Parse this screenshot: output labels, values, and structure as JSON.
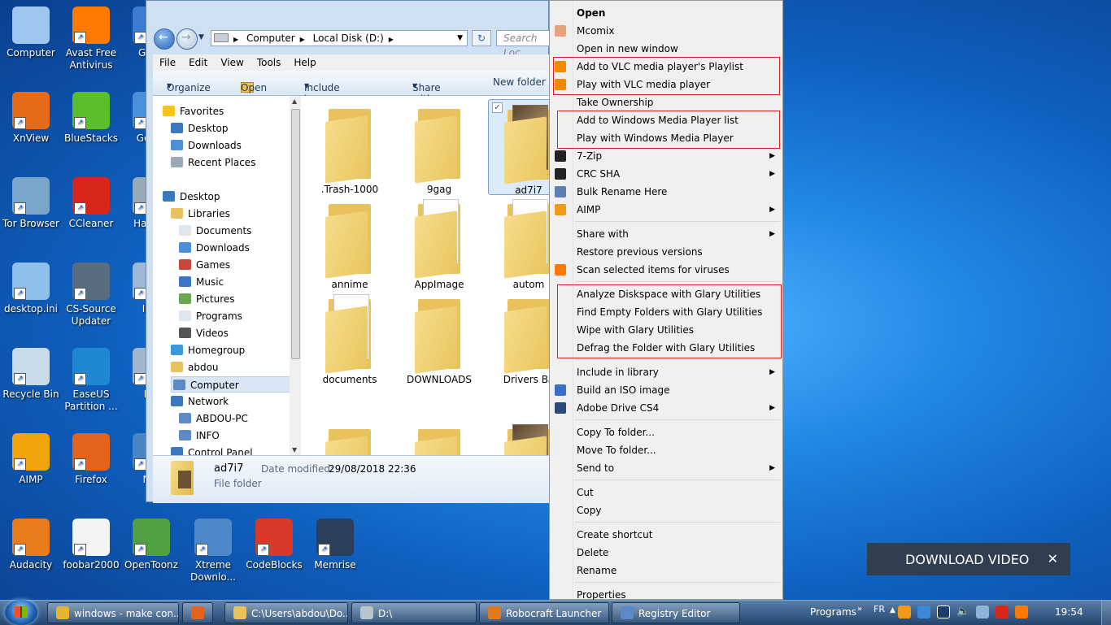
{
  "desktop": {
    "icons": [
      {
        "label": "Computer",
        "col": 0,
        "row": 0,
        "color": "#9ec7ef"
      },
      {
        "label": "Avast Free Antivirus",
        "col": 1,
        "row": 0,
        "color": "#ff7a00"
      },
      {
        "label": "Glary",
        "col": 2,
        "row": 0,
        "color": "#3b7bd0"
      },
      {
        "label": "XnView",
        "col": 0,
        "row": 1,
        "color": "#e66a19"
      },
      {
        "label": "BlueStacks",
        "col": 1,
        "row": 1,
        "color": "#5bbf2b"
      },
      {
        "label": "Go Ch",
        "col": 2,
        "row": 1,
        "color": "#4a8fd9"
      },
      {
        "label": "Tor Browser",
        "col": 0,
        "row": 2,
        "color": "#7aa6c9"
      },
      {
        "label": "CCleaner",
        "col": 1,
        "row": 2,
        "color": "#d8261b"
      },
      {
        "label": "Hak De",
        "col": 2,
        "row": 2,
        "color": "#9aa9b8"
      },
      {
        "label": "desktop.ini",
        "col": 0,
        "row": 3,
        "color": "#8fbfea"
      },
      {
        "label": "CS-Source Updater",
        "col": 1,
        "row": 3,
        "color": "#5a6d80"
      },
      {
        "label": "Ima",
        "col": 2,
        "row": 3,
        "color": "#9db8d6"
      },
      {
        "label": "Recycle Bin",
        "col": 0,
        "row": 4,
        "color": "#c7dbe9"
      },
      {
        "label": "EaseUS Partition ...",
        "col": 1,
        "row": 4,
        "color": "#1e88d3"
      },
      {
        "label": "Mir",
        "col": 2,
        "row": 4,
        "color": "#a1b6cc"
      },
      {
        "label": "AIMP",
        "col": 0,
        "row": 5,
        "color": "#f0a50a"
      },
      {
        "label": "Firefox",
        "col": 1,
        "row": 5,
        "color": "#e5621b"
      },
      {
        "label": "Net",
        "col": 2,
        "row": 5,
        "color": "#4b86c4"
      },
      {
        "label": "Audacity",
        "col": 0,
        "row": 6,
        "color": "#e87b1c"
      },
      {
        "label": "foobar2000",
        "col": 1,
        "row": 6,
        "color": "#f4f4f4"
      },
      {
        "label": "OpenToonz",
        "col": 2,
        "row": 6,
        "color": "#52a044"
      },
      {
        "label": "Xtreme Downlo...",
        "col": 3,
        "row": 6,
        "color": "#4f88c9"
      },
      {
        "label": "CodeBlocks",
        "col": 4,
        "row": 6,
        "color": "#d83a2a"
      },
      {
        "label": "Memrise",
        "col": 5,
        "row": 6,
        "color": "#2b3f5c"
      }
    ]
  },
  "explorer": {
    "address": {
      "segments": [
        "Computer",
        "Local Disk (D:)"
      ],
      "search_placeholder": "Search Loc"
    },
    "menu": [
      "File",
      "Edit",
      "View",
      "Tools",
      "Help"
    ],
    "toolbar": [
      "Organize",
      "Open",
      "Include in library",
      "Share with",
      "New folder"
    ],
    "nav": [
      {
        "label": "Favorites",
        "indent": 0,
        "icon": "star-icon"
      },
      {
        "label": "Desktop",
        "indent": 1,
        "icon": "desktop-icon"
      },
      {
        "label": "Downloads",
        "indent": 1,
        "icon": "downloads-icon"
      },
      {
        "label": "Recent Places",
        "indent": 1,
        "icon": "recent-places-icon"
      },
      {
        "label": "",
        "indent": 0,
        "icon": ""
      },
      {
        "label": "Desktop",
        "indent": 0,
        "icon": "desktop-icon"
      },
      {
        "label": "Libraries",
        "indent": 1,
        "icon": "libraries-icon"
      },
      {
        "label": "Documents",
        "indent": 2,
        "icon": "documents-icon"
      },
      {
        "label": "Downloads",
        "indent": 2,
        "icon": "downloads-icon"
      },
      {
        "label": "Games",
        "indent": 2,
        "icon": "games-icon"
      },
      {
        "label": "Music",
        "indent": 2,
        "icon": "music-icon"
      },
      {
        "label": "Pictures",
        "indent": 2,
        "icon": "pictures-icon"
      },
      {
        "label": "Programs",
        "indent": 2,
        "icon": "programs-icon"
      },
      {
        "label": "Videos",
        "indent": 2,
        "icon": "videos-icon"
      },
      {
        "label": "Homegroup",
        "indent": 1,
        "icon": "homegroup-icon"
      },
      {
        "label": "abdou",
        "indent": 1,
        "icon": "user-folder-icon"
      },
      {
        "label": "Computer",
        "indent": 1,
        "icon": "computer-icon",
        "selected": true
      },
      {
        "label": "Network",
        "indent": 1,
        "icon": "network-icon"
      },
      {
        "label": "ABDOU-PC",
        "indent": 2,
        "icon": "pc-icon"
      },
      {
        "label": "INFO",
        "indent": 2,
        "icon": "pc-icon"
      },
      {
        "label": "Control Panel",
        "indent": 1,
        "icon": "control-panel-icon"
      }
    ],
    "folders": [
      {
        "label": ".Trash-1000",
        "col": 0,
        "row": 0,
        "kind": "plain"
      },
      {
        "label": "9gag",
        "col": 1,
        "row": 0,
        "kind": "plain"
      },
      {
        "label": "ad7i7",
        "col": 2,
        "row": 0,
        "kind": "photo",
        "selected": true
      },
      {
        "label": "annime",
        "col": 0,
        "row": 1,
        "kind": "plain"
      },
      {
        "label": "AppImage",
        "col": 1,
        "row": 1,
        "kind": "paper"
      },
      {
        "label": "autom",
        "col": 2,
        "row": 1,
        "kind": "paper"
      },
      {
        "label": "documents",
        "col": 0,
        "row": 2,
        "kind": "paper"
      },
      {
        "label": "DOWNLOADS",
        "col": 1,
        "row": 2,
        "kind": "plain"
      },
      {
        "label": "Drivers Ba",
        "col": 2,
        "row": 2,
        "kind": "plain"
      },
      {
        "label": "",
        "col": 0,
        "row": 3,
        "kind": "plain"
      },
      {
        "label": "",
        "col": 1,
        "row": 3,
        "kind": "plain"
      },
      {
        "label": "",
        "col": 2,
        "row": 3,
        "kind": "photo"
      }
    ],
    "details": {
      "name": "ad7i7",
      "modified_label": "Date modified:",
      "modified": "29/08/2018 22:36",
      "type": "File folder"
    }
  },
  "context_menu": {
    "items": [
      {
        "label": "Open",
        "bold": true,
        "icon": ""
      },
      {
        "label": "Mcomix",
        "icon": "mcomix-icon",
        "color": "#e8a27a"
      },
      {
        "label": "Open in new window",
        "icon": ""
      },
      {
        "label": "Add to VLC media player's Playlist",
        "icon": "vlc-icon",
        "color": "#f08a00"
      },
      {
        "label": "Play with VLC media player",
        "icon": "vlc-icon",
        "color": "#f08a00"
      },
      {
        "label": "Take Ownership",
        "icon": ""
      },
      {
        "label": "Add to Windows Media Player list",
        "icon": ""
      },
      {
        "label": "Play with Windows Media Player",
        "icon": ""
      },
      {
        "label": "7-Zip",
        "icon": "7zip-icon",
        "color": "#222222",
        "submenu": true
      },
      {
        "label": "CRC SHA",
        "icon": "7zip-icon",
        "color": "#222222",
        "submenu": true
      },
      {
        "label": "Bulk Rename Here",
        "icon": "bulk-rename-icon",
        "color": "#5a7fb0"
      },
      {
        "label": "AIMP",
        "icon": "aimp-icon",
        "color": "#f09a18",
        "submenu": true
      },
      {
        "label": "Share with",
        "icon": "",
        "submenu": true,
        "gap": true
      },
      {
        "label": "Restore previous versions",
        "icon": ""
      },
      {
        "label": "Scan selected items for viruses",
        "icon": "avast-icon",
        "color": "#ff7800"
      },
      {
        "label": "Analyze Diskspace with Glary Utilities",
        "icon": "",
        "gap": true
      },
      {
        "label": "Find Empty Folders with Glary Utilities",
        "icon": ""
      },
      {
        "label": "Wipe with Glary Utilities",
        "icon": ""
      },
      {
        "label": "Defrag the Folder with Glary Utilities",
        "icon": ""
      },
      {
        "label": "Include in library",
        "icon": "",
        "submenu": true,
        "gap": true
      },
      {
        "label": "Build an ISO image",
        "icon": "iso-icon",
        "color": "#3a6fc7"
      },
      {
        "label": "Adobe Drive CS4",
        "icon": "adobe-drive-icon",
        "color": "#2c4a78",
        "submenu": true
      },
      {
        "label": "Copy To folder...",
        "icon": "",
        "gap": true
      },
      {
        "label": "Move To folder...",
        "icon": ""
      },
      {
        "label": "Send to",
        "icon": "",
        "submenu": true
      },
      {
        "label": "Cut",
        "icon": "",
        "gap": true
      },
      {
        "label": "Copy",
        "icon": ""
      },
      {
        "label": "Create shortcut",
        "icon": "",
        "gap": true
      },
      {
        "label": "Delete",
        "icon": ""
      },
      {
        "label": "Rename",
        "icon": ""
      },
      {
        "label": "Properties",
        "icon": "",
        "gap": true
      }
    ]
  },
  "download_overlay": {
    "label": "DOWNLOAD VIDEO",
    "close": "✕"
  },
  "taskbar": {
    "buttons": [
      {
        "label": "windows - make con...",
        "icon": "chrome-icon",
        "color": "#e3b530"
      },
      {
        "label": "",
        "icon": "firefox-icon",
        "color": "#e5621b"
      },
      {
        "label": "C:\\Users\\abdou\\Do...",
        "icon": "folder-icon",
        "color": "#e8c25c"
      },
      {
        "label": "D:\\",
        "icon": "drive-icon",
        "color": "#b8c4d0"
      },
      {
        "label": "Robocraft Launcher",
        "icon": "robocraft-icon",
        "color": "#e07a1c"
      },
      {
        "label": "Registry Editor",
        "icon": "registry-icon",
        "color": "#5d8ac4"
      }
    ],
    "programs_label": "Programs",
    "language": "FR",
    "clock": "19:54"
  }
}
